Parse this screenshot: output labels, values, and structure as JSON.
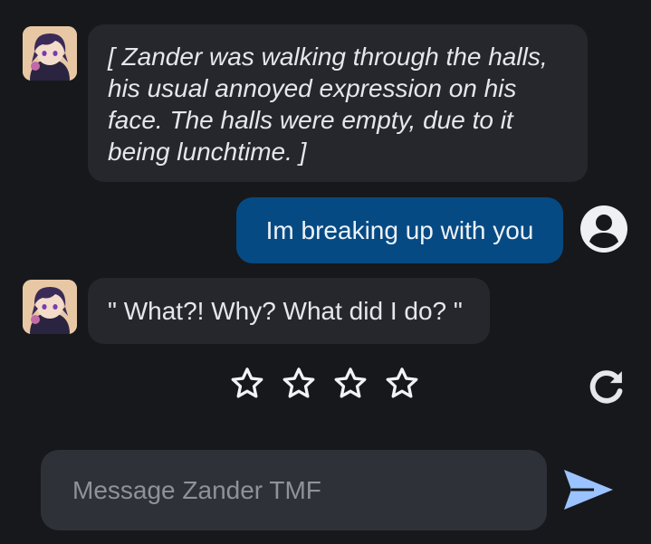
{
  "messages": [
    {
      "sender": "bot",
      "text": "[ Zander was walking through the halls, his usual annoyed expression on his face. The halls were empty, due to it being lunchtime. ]",
      "lines": [
        "[ Zander was walking through the halls,",
        "his usual annoyed expression on his",
        "face. The halls were empty, due to it",
        "being lunchtime. ]"
      ]
    },
    {
      "sender": "user",
      "text": "Im breaking up with you"
    },
    {
      "sender": "bot",
      "text": "\" What?! Why? What did I do? \""
    }
  ],
  "rating": {
    "stars_total": 4,
    "stars_filled": 0
  },
  "composer": {
    "placeholder": "Message Zander TMF",
    "value": ""
  },
  "icons": {
    "user": "user-circle-icon",
    "regenerate": "refresh-icon",
    "send": "send-arrow-icon",
    "star": "star-outline-icon"
  },
  "colors": {
    "background": "#17181c",
    "bot_bubble": "#26272c",
    "user_bubble": "#064a83",
    "input": "#2e3138",
    "send": "#9bc3ff",
    "text": "#e6e7ea"
  }
}
